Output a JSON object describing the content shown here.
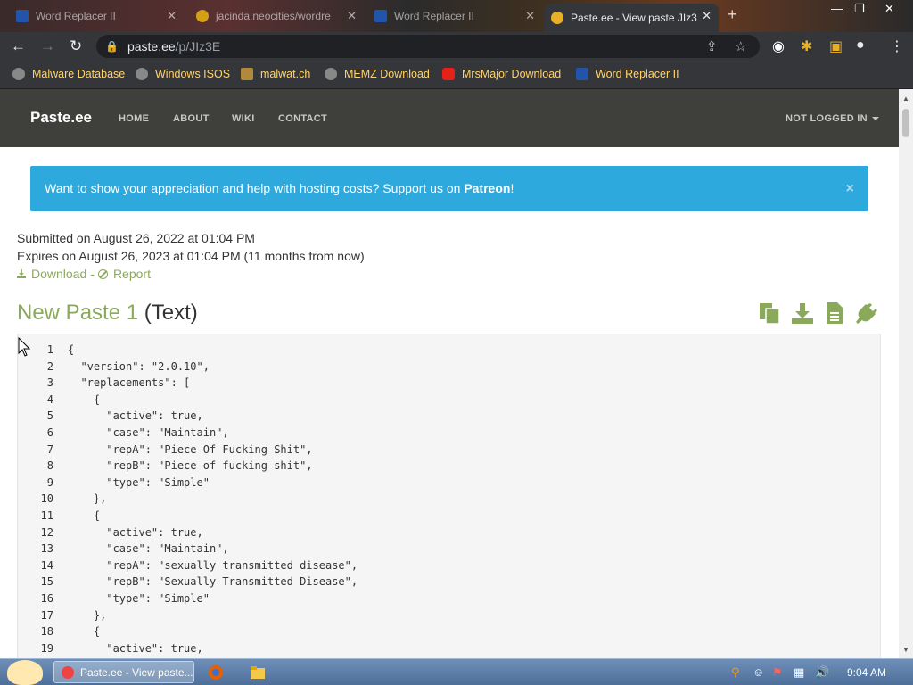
{
  "browser": {
    "tabs": [
      {
        "title": "Word Replacer II"
      },
      {
        "title": "jacinda.neocities/wordre"
      },
      {
        "title": "Word Replacer II"
      },
      {
        "title": "Paste.ee - View paste JIz3"
      }
    ],
    "address": {
      "host": "paste.ee",
      "path": "/p/JIz3E"
    },
    "bookmarks": [
      {
        "label": "Malware Database"
      },
      {
        "label": "Windows ISOS"
      },
      {
        "label": "malwat.ch"
      },
      {
        "label": "MEMZ Download"
      },
      {
        "label": "MrsMajor Download"
      },
      {
        "label": "Word Replacer II"
      }
    ]
  },
  "site": {
    "brand": "Paste.ee",
    "nav": [
      "HOME",
      "ABOUT",
      "WIKI",
      "CONTACT"
    ],
    "login": "NOT LOGGED IN"
  },
  "alert": {
    "text": "Want to show your appreciation and help with hosting costs? Support us on ",
    "link": "Patreon",
    "suffix": "!",
    "close": "×"
  },
  "paste": {
    "submitted": "Submitted on August 26, 2022 at 01:04 PM",
    "expires": "Expires on August 26, 2023 at 01:04 PM (11 months from now)",
    "download": "Download",
    "separator": "-",
    "report": "Report",
    "name": "New Paste 1",
    "type": "(Text)",
    "lines": [
      "{",
      "  \"version\": \"2.0.10\",",
      "  \"replacements\": [",
      "    {",
      "      \"active\": true,",
      "      \"case\": \"Maintain\",",
      "      \"repA\": \"Piece Of Fucking Shit\",",
      "      \"repB\": \"Piece of fucking shit\",",
      "      \"type\": \"Simple\"",
      "    },",
      "    {",
      "      \"active\": true,",
      "      \"case\": \"Maintain\",",
      "      \"repA\": \"sexually transmitted disease\",",
      "      \"repB\": \"Sexually Transmitted Disease\",",
      "      \"type\": \"Simple\"",
      "    },",
      "    {",
      "      \"active\": true,"
    ]
  },
  "taskbar": {
    "active_task": "Paste.ee - View paste...",
    "clock": "9:04 AM"
  },
  "colors": {
    "accent_green": "#8aa95b",
    "alert_blue": "#2ea9de",
    "navbar": "#3f3f3c",
    "bookmark_text": "#ffd36a"
  }
}
